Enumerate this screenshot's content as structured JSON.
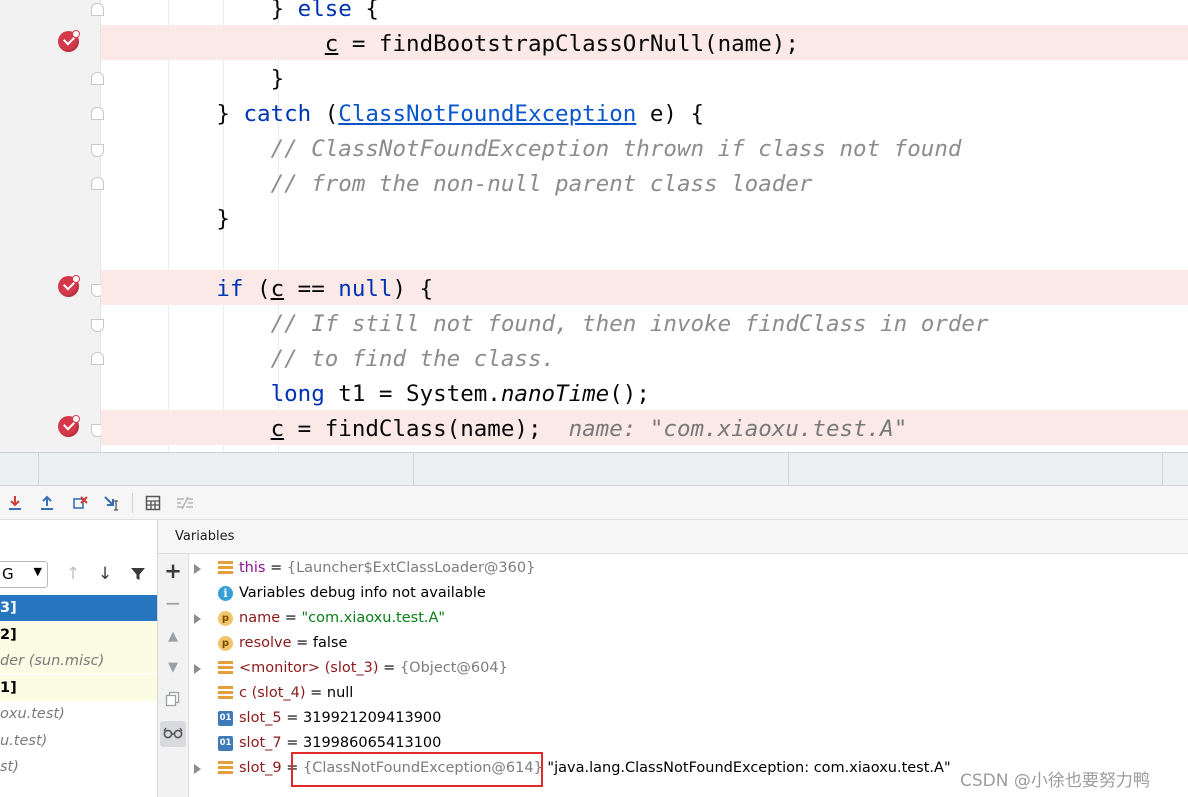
{
  "editor": {
    "lines": [
      {
        "indent": "            ",
        "parts": [
          [
            "p",
            "} "
          ],
          [
            "k",
            "else"
          ],
          [
            "p",
            " {"
          ]
        ]
      },
      {
        "indent": "                ",
        "parts": [
          [
            "u",
            "c"
          ],
          [
            "p",
            " = findBootstrapClassOrNull(name);"
          ]
        ]
      },
      {
        "indent": "            ",
        "parts": [
          [
            "p",
            "}"
          ]
        ]
      },
      {
        "indent": "        ",
        "parts": [
          [
            "p",
            "} "
          ],
          [
            "k",
            "catch"
          ],
          [
            "p",
            " ("
          ],
          [
            "l",
            "ClassNotFoundException"
          ],
          [
            "p",
            " e) {"
          ]
        ]
      },
      {
        "indent": "            ",
        "parts": [
          [
            "c",
            "// ClassNotFoundException thrown if class not found"
          ]
        ]
      },
      {
        "indent": "            ",
        "parts": [
          [
            "c",
            "// from the non-null parent class loader"
          ]
        ]
      },
      {
        "indent": "        ",
        "parts": [
          [
            "p",
            "}"
          ]
        ]
      },
      {
        "indent": "",
        "parts": []
      },
      {
        "indent": "        ",
        "parts": [
          [
            "k",
            "if"
          ],
          [
            "p",
            " ("
          ],
          [
            "u",
            "c"
          ],
          [
            "p",
            " == "
          ],
          [
            "k",
            "null"
          ],
          [
            "p",
            ") {"
          ]
        ]
      },
      {
        "indent": "            ",
        "parts": [
          [
            "c",
            "// If still not found, then invoke findClass in order"
          ]
        ]
      },
      {
        "indent": "            ",
        "parts": [
          [
            "c",
            "// to find the class."
          ]
        ]
      },
      {
        "indent": "            ",
        "parts": [
          [
            "k",
            "long"
          ],
          [
            "p",
            " t1 = System."
          ],
          [
            "i",
            "nanoTime"
          ],
          [
            "p",
            "();"
          ]
        ]
      },
      {
        "indent": "            ",
        "parts": [
          [
            "u",
            "c"
          ],
          [
            "p",
            " = findClass(name);  "
          ],
          [
            "h",
            "name: \"com.xiaoxu.test.A\""
          ]
        ]
      }
    ]
  },
  "panel": {
    "variables_title": "Variables",
    "thread_select_value": "G",
    "frames": [
      {
        "text": "3]",
        "style": "sel"
      },
      {
        "text": "2]",
        "style": "yel"
      },
      {
        "text": "der (sun.misc)",
        "style": "yel-ital"
      },
      {
        "text": "1]",
        "style": "yel"
      },
      {
        "text": "oxu.test)",
        "style": "gray"
      },
      {
        "text": "u.test)",
        "style": "gray"
      },
      {
        "text": "st)",
        "style": "gray"
      }
    ],
    "variables": [
      {
        "icon": "field",
        "expand": true,
        "name": "this",
        "name_color": "vn",
        "eq": " = ",
        "value": "{Launcher$ExtClassLoader@360}",
        "value_color": "gv",
        "extra": ""
      },
      {
        "icon": "info",
        "expand": false,
        "name": "",
        "name_color": "plain",
        "eq": "",
        "value": "Variables debug info not available",
        "value_color": "plain",
        "extra": ""
      },
      {
        "icon": "p",
        "expand": true,
        "name": "name",
        "name_color": "vn2",
        "eq": " = ",
        "value": "\"com.xiaoxu.test.A\"",
        "value_color": "sv",
        "extra": ""
      },
      {
        "icon": "p",
        "expand": false,
        "name": "resolve",
        "name_color": "vn2",
        "eq": " = ",
        "value": "false",
        "value_color": "bv",
        "extra": ""
      },
      {
        "icon": "field",
        "expand": true,
        "name": "<monitor> (slot_3)",
        "name_color": "vn2",
        "eq": " = ",
        "value": "{Object@604}",
        "value_color": "gv",
        "extra": ""
      },
      {
        "icon": "field",
        "expand": false,
        "name": "c (slot_4)",
        "name_color": "vn2",
        "eq": " = ",
        "value": "null",
        "value_color": "bv",
        "extra": ""
      },
      {
        "icon": "01",
        "expand": false,
        "name": "slot_5",
        "name_color": "vn2",
        "eq": " = ",
        "value": "319921209413900",
        "value_color": "bv",
        "extra": ""
      },
      {
        "icon": "01",
        "expand": false,
        "name": "slot_7",
        "name_color": "vn2",
        "eq": " = ",
        "value": "319986065413100",
        "value_color": "bv",
        "extra": ""
      },
      {
        "icon": "field",
        "expand": true,
        "name": "slot_9",
        "name_color": "vn2",
        "eq": " = ",
        "value": "{ClassNotFoundException@614}",
        "value_color": "gv",
        "extra": " \"java.lang.ClassNotFoundException: com.xiaoxu.test.A\""
      }
    ]
  },
  "watermark": "CSDN @小徐也要努力鸭",
  "icons": {
    "breakpoint": "breakpoint-icon",
    "step_into": "step-into-icon",
    "step_out": "step-out-icon",
    "drop_frame": "drop-frame-icon",
    "run_to_cursor": "run-to-cursor-icon",
    "evaluate": "evaluate-icon",
    "trace": "trace-icon",
    "add": "add-icon",
    "remove": "remove-icon",
    "up": "arrow-up-icon",
    "down": "arrow-down-icon",
    "filter": "filter-icon",
    "copy": "copy-icon",
    "glasses": "glasses-icon"
  },
  "colors": {
    "highlight_line": "#fae9e6",
    "keyword": "#0033b3",
    "comment": "#8c8c8c",
    "selection": "#2675bf",
    "annotation_box": "#e22a2a"
  }
}
